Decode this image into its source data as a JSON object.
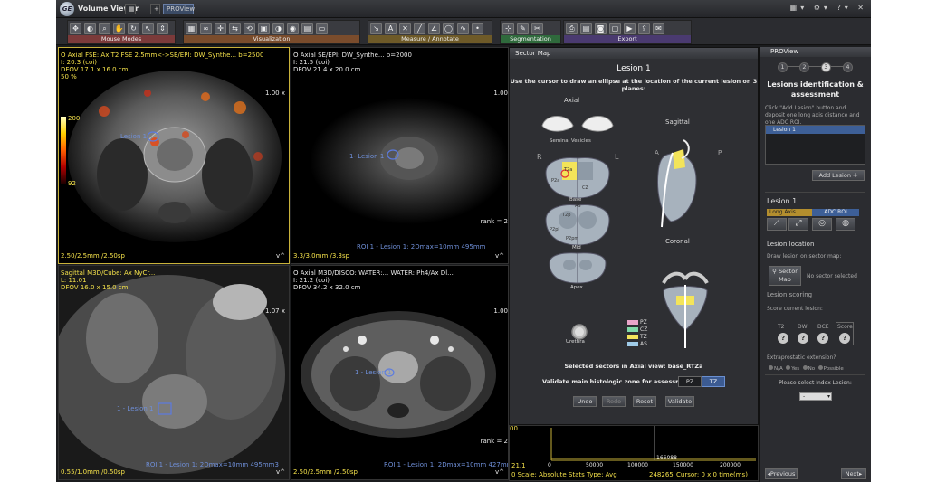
{
  "window": {
    "title": "Volume Viewer",
    "tab": "PROView",
    "add": "+",
    "ctrls": "▦▾ ⚙▾ ?▾ ✕"
  },
  "toolbar": {
    "groups": [
      {
        "label": "Mouse Modes"
      },
      {
        "label": "Visualization"
      },
      {
        "label": "Measure / Annotate"
      },
      {
        "label": "Segmentation"
      },
      {
        "label": "Export"
      }
    ]
  },
  "viewports": {
    "tl": {
      "lines": [
        "O  Axial FSE: Ax T2 FSE 2.5mm<->SE/EPI: DW_Synthe... b=2500",
        "I: 20.3 (coi)",
        "DFOV 17.1 x 16.0 cm",
        "50 %"
      ],
      "zoom": "1.00 x",
      "scale_top": "200",
      "scale_bot": "92",
      "lesion": "Lesion 1",
      "footer": "2.50/2.5mm /2.50sp",
      "corner": "v^"
    },
    "tr": {
      "lines": [
        "O  Axial SE/EPI: DW_Synthe... b=2000",
        "I: 21.5 (coi)",
        "DFOV 21.4 x 20.0 cm"
      ],
      "zoom": "1.00",
      "lesion": "1- Lesion 1",
      "rank": "rank = 2",
      "roi": "ROI 1 - Lesion 1: 2Dmax=10mm 495mm",
      "footer": "3.3/3.0mm /3.3sp",
      "corner": "v^"
    },
    "bl": {
      "lines": [
        "Sagittal M3D/Cube: Ax NyCr...",
        "L: 11.01",
        "DFOV 16.0 x 15.0 cm"
      ],
      "zoom": "1.07 x",
      "lesion": "1 - Lesion 1",
      "roi": "ROI 1 - Lesion 1: 2Dmax=10mm 495mm3",
      "footer": "0.55/1.0mm /0.50sp",
      "corner": "v^"
    },
    "bm": {
      "lines": [
        "O  Axial M3D/DISCO: WATER:... WATER: Ph4/Ax Dl...",
        "I: 21.2 (coi)",
        "DFOV 34.2 x 32.0 cm"
      ],
      "zoom": "1.00",
      "lesion": "1 - Lesion 1",
      "rank": "rank = 2",
      "roi": "ROI 1 - Lesion 1: 2Dmax=10mm 427mm3",
      "footer": "2.50/2.5mm /2.50sp",
      "corner": "v^"
    },
    "br": {
      "y_value": "21.1",
      "x_ticks": [
        "0",
        "50000",
        "100000",
        "150000",
        "200000"
      ],
      "peak_label": "166088",
      "status": "0 Scale: Absolute  Stats Type: Avg",
      "status_val": "248265",
      "cursor": "Cursor:  0 x 0 time(ms)",
      "edge": "00"
    }
  },
  "sector_map": {
    "title": "Sector Map",
    "heading": "Lesion 1",
    "instruction": "Use the cursor to draw an ellipse at the location of the current lesion on 3 planes:",
    "axial": "Axial",
    "seminal": "Seminal Vesicles",
    "sagittal": "Sagittal",
    "coronal": "Coronal",
    "base": "Base",
    "mid": "Mid",
    "apex": "Apex",
    "urethra": "Urethra",
    "R": "R",
    "L": "L",
    "A": "A",
    "P": "P",
    "zones": {
      "t2a": "T2a",
      "t2p": "T2p",
      "cz": "CZ",
      "as": "AS",
      "p2a": "P2a",
      "p2pm": "P2pm",
      "p2pl": "P2pl"
    },
    "legend": [
      {
        "label": "PZ",
        "color": "#e9a5c9"
      },
      {
        "label": "CZ",
        "color": "#7fd9a8"
      },
      {
        "label": "TZ",
        "color": "#f3e45a"
      },
      {
        "label": "AS",
        "color": "#9fcbe8"
      }
    ],
    "selected": "Selected sectors in Axial view: base_RTZa",
    "validate_zone": "Validate main histologic zone for assessment:",
    "zone_pz": "PZ",
    "zone_tz": "TZ",
    "btn_undo": "Undo",
    "btn_redo": "Redo",
    "btn_reset": "Reset",
    "btn_validate": "Validate"
  },
  "panel": {
    "title": "PROView",
    "steps": [
      "1",
      "2",
      "3",
      "4"
    ],
    "heading": "Lesions identification & assessment",
    "hint": "Click \"Add Lesion\" button and deposit one long axis distance and one ADC ROI.",
    "list_item": "Lesion 1",
    "add_lesion": "Add Lesion",
    "lesion_title": "Lesion 1",
    "long_axis": "Long Axis",
    "adc_roi": "ADC ROI",
    "loc_title": "Lesion location",
    "loc_hint": "Draw lesion on sector map:",
    "sector_btn": "Sector Map",
    "no_sector": "No sector selected",
    "scoring_title": "Lesion scoring",
    "scoring_hint": "Score current lesion:",
    "t2": "T2",
    "dwi": "DWI",
    "dce": "DCE",
    "score": "Score",
    "q": "?",
    "extra": "Extraprostatic extension?",
    "opt_na": "N/A",
    "opt_yes": "Yes",
    "opt_no": "No",
    "opt_possible": "Possible",
    "index": "Please select Index Lesion:",
    "select_val": "-",
    "prev": "Previous",
    "next": "Next"
  }
}
